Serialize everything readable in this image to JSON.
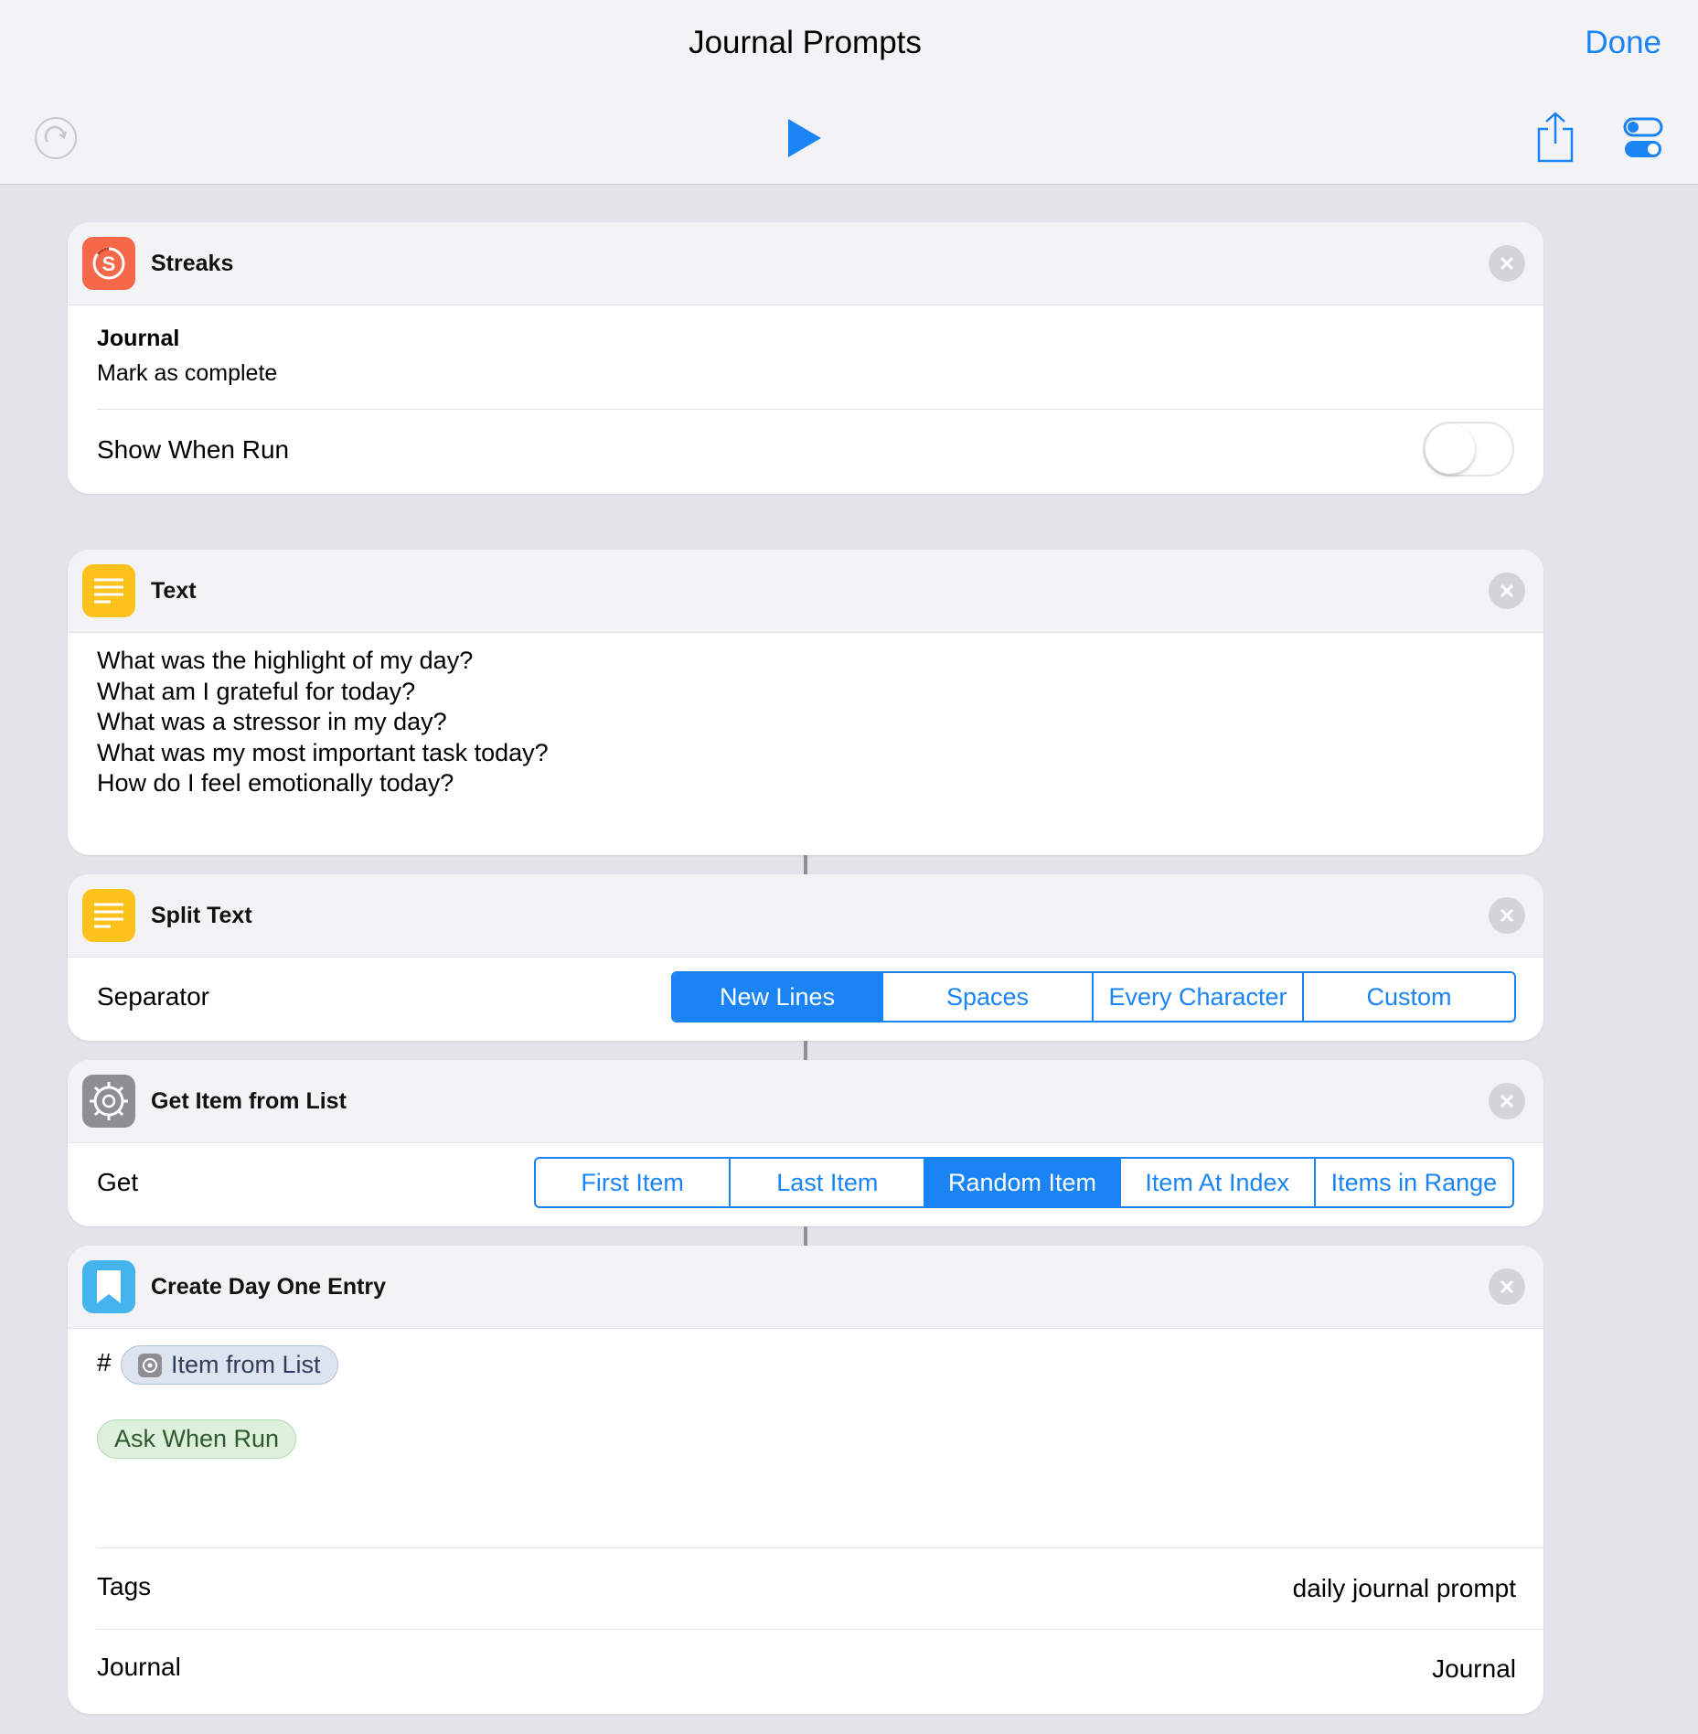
{
  "header": {
    "title": "Journal Prompts",
    "done_label": "Done"
  },
  "toolbar": {
    "icons": [
      "undo-icon",
      "play-icon",
      "share-icon",
      "settings-toggle-icon"
    ]
  },
  "actions": {
    "streaks": {
      "title": "Streaks",
      "icon": "streaks-app-icon",
      "icon_letter": "S",
      "habit_name": "Journal",
      "habit_action": "Mark as complete",
      "show_when_run_label": "Show When Run",
      "show_when_run": false
    },
    "text": {
      "title": "Text",
      "icon": "text-app-icon",
      "lines": [
        "What was the highlight of my day?",
        "What am I grateful for today?",
        "What was a stressor in my day?",
        "What was my most important task today?",
        "How do I feel emotionally today?"
      ]
    },
    "split_text": {
      "title": "Split Text",
      "icon": "split-text-app-icon",
      "separator_label": "Separator",
      "options": [
        "New Lines",
        "Spaces",
        "Every Character",
        "Custom"
      ],
      "selected": "New Lines"
    },
    "get_item": {
      "title": "Get Item from List",
      "icon": "gear-app-icon",
      "get_label": "Get",
      "options": [
        "First Item",
        "Last Item",
        "Random Item",
        "Item At Index",
        "Items in Range"
      ],
      "selected": "Random Item"
    },
    "day_one": {
      "title": "Create Day One Entry",
      "icon": "day-one-app-icon",
      "hash": "#",
      "variable_token": "Item from List",
      "ask_token": "Ask When Run",
      "tags_label": "Tags",
      "tags_value": "daily journal prompt",
      "journal_label": "Journal",
      "journal_value": "Journal"
    }
  },
  "colors": {
    "accent": "#1a84f5",
    "streaks": "#f5684a",
    "text_app": "#fcc21b",
    "gear_app": "#8e8e93",
    "day_one": "#44b3ee"
  }
}
